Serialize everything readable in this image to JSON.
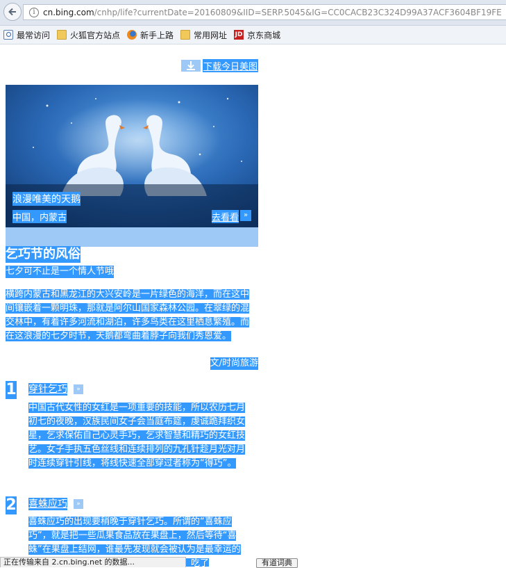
{
  "browser": {
    "url_host": "cn.bing.com",
    "url_path": "/cnhp/life?currentDate=20160809&IID=SERP.5045&IG=CC0CACB23C324D99A37ACF3604BF19FE",
    "bookmarks": [
      {
        "label": "最常访问",
        "icon": "search-icon"
      },
      {
        "label": "火狐官方站点",
        "icon": "folder-icon"
      },
      {
        "label": "新手上路",
        "icon": "firefox-icon"
      },
      {
        "label": "常用网址",
        "icon": "folder-icon"
      },
      {
        "label": "京东商城",
        "icon": "jd-icon",
        "icon_text": "JD"
      }
    ]
  },
  "page": {
    "download_label": "下载今日美图",
    "hero": {
      "title": "浪漫唯美的天鹅",
      "location": "中国，内蒙古",
      "go_label": "去看看"
    },
    "article": {
      "title": "乞巧节的风俗",
      "subtitle": "七夕可不止是一个情人节哦",
      "body": "横跨内蒙古和黑龙江的大兴安岭是一片绿色的海洋，而在这中间镶嵌着一颗明珠，那就是阿尔山国家森林公园。在翠绿的混交林中，有着许多河流和湖泊，许多鸟类在这里栖息繁殖。而在这浪漫的七夕时节，天鹅都弯曲着脖子向我们秀恩爱。",
      "author": "文/时尚旅游"
    },
    "sections": [
      {
        "number": "1",
        "title": "穿针乞巧",
        "body": "中国古代女性的女红是一项重要的技能，所以农历七月初七的夜晚，汉族民间女子会当庭布筵，虔诚跪拜织女星，乞求保佑自己心灵手巧，乞求智慧和精巧的女红技艺。女子手执五色丝线和连续排列的九孔针趁月光对月时连续穿针引线，将线快速全部穿过者称为“得巧”。"
      },
      {
        "number": "2",
        "title": "喜蛛应巧",
        "body": "喜蛛应巧的出现要稍晚于穿针乞巧。所谓的“喜蛛应巧”，就是把一些瓜果食品放在果盘上，然后等待“喜蛛”在果盘上结网，谁最先发现就会被认为是最幸运的人。而结网后女孩子会把瓜果分到各人，吃了"
      }
    ],
    "status_text": "正在传输来自 2.cn.bing.net 的数据...",
    "dict_button_label": "有道词典"
  },
  "colors": {
    "selection": "#3399ff",
    "selection_light": "#9ec9f7"
  }
}
